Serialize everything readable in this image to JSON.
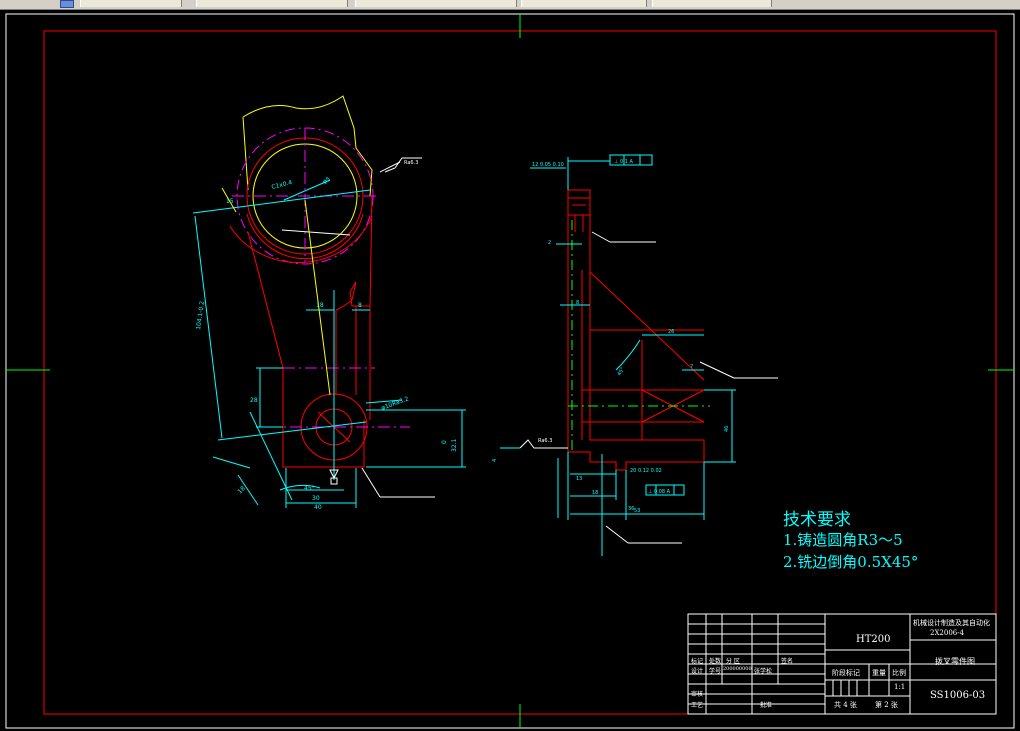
{
  "window": {
    "tabs": [
      "",
      "",
      "",
      "",
      ""
    ]
  },
  "tech_requirements": {
    "title": "技术要求",
    "items": [
      "1.铸造圆角R3～5",
      "2.铣边倒角0.5X45°"
    ]
  },
  "title_block": {
    "material": "HT200",
    "project": "机械设计制造及其自动化",
    "project_code": "2X2006-4",
    "part_name": "拨叉零件图",
    "drawing_no": "SS1006-03",
    "scale_label": "比例",
    "scale": "1:1",
    "weight_label": "重量",
    "stage_label": "阶段标记",
    "sheets_total": "共 4 张",
    "sheet_no": "第 2 张",
    "rows": [
      [
        "标记",
        "处数",
        "分 区",
        "",
        "签名"
      ],
      [
        "设计",
        "学号",
        "200000000",
        "张学松",
        ""
      ],
      [
        "审核",
        "",
        "",
        "",
        ""
      ],
      [
        "工艺",
        "",
        "",
        "批准",
        ""
      ]
    ]
  },
  "annotations": {
    "left_view": {
      "roughness_top": "Ra6.3",
      "chamfer": "C1x0.4",
      "bore_top": "φ5",
      "dim_vertical_long": "104.1-0.2",
      "dim_rib_width": "8",
      "dim_rib_gap": "18",
      "dim_lower_height": "28",
      "bore_lower": "φ10Ra3.2",
      "dim_right_height": "32.1",
      "dim_right_0": "0",
      "dim_bottom_angle": "45°",
      "dim_bottom_width": "30",
      "dim_bottom_total": "40",
      "dim_diag": "18",
      "dim_offset": "15"
    },
    "right_view": {
      "tolerance_top": "12 0.05 0.10",
      "gdt_top": "⊥ 0.1 A",
      "dim_2": "2",
      "dim_8": "8",
      "dim_26": "26",
      "dim_7": "7",
      "angle_45": "45°",
      "dim_46": "46",
      "roughness_bottom": "Ra6.3",
      "dim_4": "4",
      "dim_13": "13",
      "dim_18": "18",
      "tolerance_bottom": "20 0.12 0.02",
      "gdt_bottom": "⊥ 0.08 A",
      "dim_36": "36",
      "dim_53": "53"
    }
  },
  "colors": {
    "background": "#000000",
    "frame": "#ffffff",
    "part_outline": "#ff0000",
    "dimension": "#00ffff",
    "center_line": "#ff00ff",
    "aux_yellow": "#ffff00",
    "green": "#00ff00"
  }
}
